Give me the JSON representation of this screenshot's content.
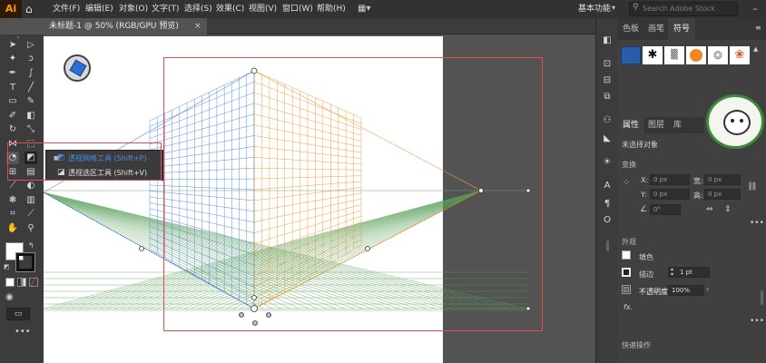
{
  "app": {
    "logo": "Ai",
    "workspace": "基本功能",
    "search_placeholder": "Search Adobe Stock"
  },
  "menu": [
    "文件(F)",
    "编辑(E)",
    "对象(O)",
    "文字(T)",
    "选择(S)",
    "效果(C)",
    "视图(V)",
    "窗口(W)",
    "帮助(H)"
  ],
  "document_tab": {
    "label": "未标题-1 @ 50% (RGB/GPU 预览)",
    "close": "×"
  },
  "flyout": {
    "items": [
      {
        "label": "透视网格工具 (Shift+P)"
      },
      {
        "label": "透视选区工具 (Shift+V)"
      }
    ]
  },
  "panel_tabs_top": [
    "色板",
    "画笔",
    "符号"
  ],
  "panel_tabs_props": [
    "属性",
    "图层",
    "库"
  ],
  "properties": {
    "no_selection": "未选择对象",
    "transform": "变换",
    "x_label": "X:",
    "x_value": "0 px",
    "y_label": "Y:",
    "y_value": "0 px",
    "w_label": "宽:",
    "w_value": "0 px",
    "h_label": "高:",
    "h_value": "0 px",
    "angle_value": "0°",
    "appearance": "外观",
    "fill_label": "填色",
    "stroke_label": "描边",
    "stroke_value": "1 pt",
    "opacity_label": "不透明度",
    "opacity_value": "100%",
    "fx_label": "fx.",
    "quick_actions": "快速操作"
  },
  "colors": {
    "accent_blue": "#4a8de0",
    "grid_blue": "#4f8fe0",
    "grid_orange": "#f0a040",
    "grid_green": "#4a9a4a",
    "highlight_red": "#e64b4b"
  }
}
